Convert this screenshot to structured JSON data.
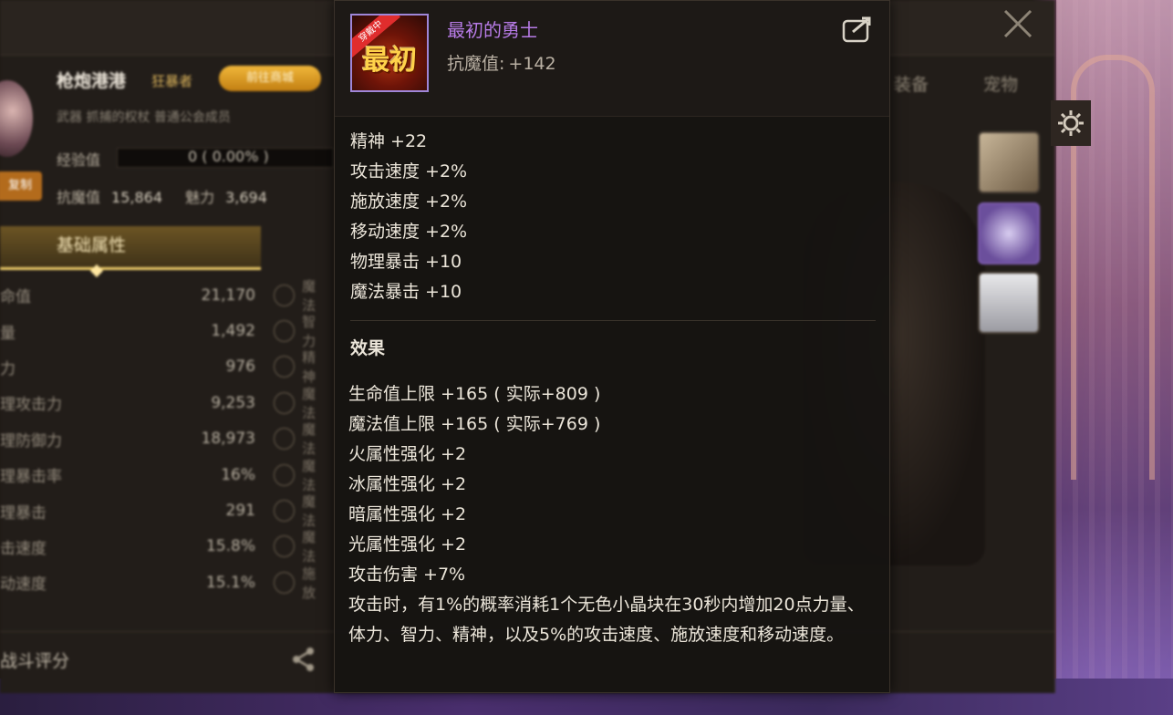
{
  "background_panel": {
    "character_name": "枪炮港港",
    "job": "狂暴者",
    "gold_button": "前往商城",
    "sub_info": "武器  抓捕的权杖  普通公会成员",
    "exp_label": "经验值",
    "exp_value": "0 ( 0.00% )",
    "tag": "复制",
    "resist_label": "抗魔值",
    "resist_value": "15,864",
    "charm_label": "魅力",
    "charm_value": "3,694",
    "tab_label": "基础属性",
    "stats": [
      {
        "label": "命值",
        "value": "21,170"
      },
      {
        "label": "量",
        "value": "1,492"
      },
      {
        "label": "力",
        "value": "976"
      },
      {
        "label": "理攻击力",
        "value": "9,253"
      },
      {
        "label": "理防御力",
        "value": "18,973"
      },
      {
        "label": "理暴击率",
        "value": "16%"
      },
      {
        "label": "理暴击",
        "value": "291"
      },
      {
        "label": "击速度",
        "value": "15.8%"
      },
      {
        "label": "动速度",
        "value": "15.1%"
      }
    ],
    "stat_icon_labels": [
      "魔法",
      "智力",
      "精神",
      "魔法",
      "魔法",
      "魔法",
      "魔法",
      "魔法",
      "施放"
    ],
    "right_tabs": [
      "装备",
      "宠物"
    ],
    "bottom_label": "战斗评分"
  },
  "tooltip": {
    "item_name": "最初的勇士",
    "item_icon_text": "最初",
    "item_icon_ribbon": "穿戴中",
    "resist_label": "抗魔值:",
    "resist_value": "+142",
    "stats": [
      "精神 +22",
      "攻击速度 +2%",
      "施放速度 +2%",
      "移动速度 +2%",
      "物理暴击 +10",
      "魔法暴击 +10"
    ],
    "effects_title": "效果",
    "effects": [
      "生命值上限 +165 ( 实际+809 )",
      "魔法值上限 +165 ( 实际+769 )",
      "火属性强化 +2",
      "冰属性强化 +2",
      "暗属性强化 +2",
      "光属性强化 +2",
      "攻击伤害 +7%"
    ],
    "description": "攻击时，有1%的概率消耗1个无色小晶块在30秒内增加20点力量、体力、智力、精神，以及5%的攻击速度、施放速度和移动速度。"
  },
  "colors": {
    "item_name": "#b77be6",
    "icon_border": "#9f86d8",
    "tab_highlight": "#f1cf6a"
  },
  "icons": {
    "close": "close-icon",
    "export": "export-icon",
    "share": "share-icon",
    "gear": "gear-icon"
  }
}
